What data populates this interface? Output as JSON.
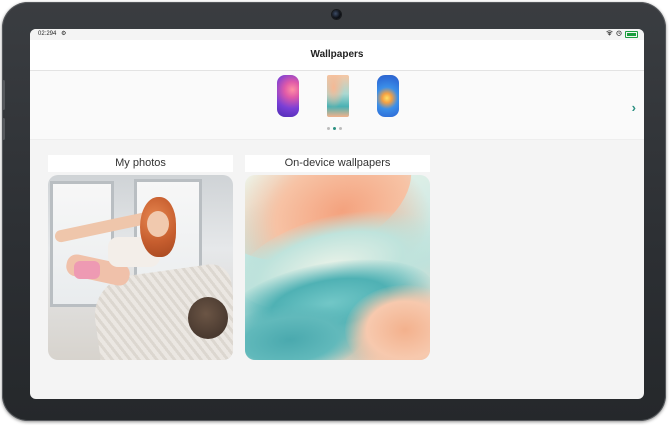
{
  "status_bar": {
    "time": "02:29",
    "time_suffix": "4",
    "settings_icon": "gear-icon",
    "right_icons": [
      "wifi-icon",
      "alarm-icon",
      "battery-icon"
    ],
    "battery_color": "#1b9e3e"
  },
  "header": {
    "title": "Wallpapers"
  },
  "preview_carousel": {
    "items": [
      {
        "icon": "wallpaper-thumbnail-purple"
      },
      {
        "icon": "wallpaper-thumbnail-teal-peach"
      },
      {
        "icon": "wallpaper-thumbnail-blue-orange"
      }
    ],
    "page_dots": 3,
    "active_dot": 2,
    "next_icon": "chevron-right-icon",
    "accent_color": "#2a8f80"
  },
  "sections": {
    "my_photos_label": "My photos",
    "on_device_label": "On-device wallpapers"
  }
}
